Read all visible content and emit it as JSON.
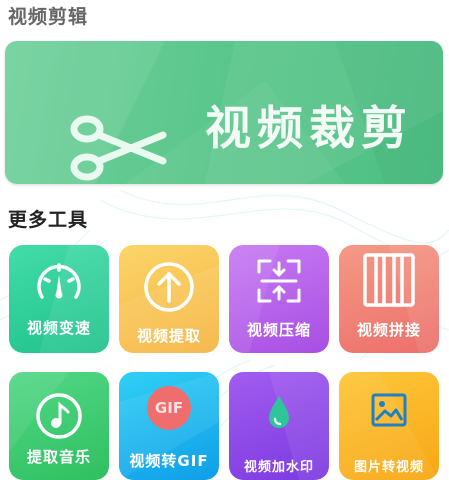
{
  "sections": {
    "edit_title": "视频剪辑",
    "more_title": "更多工具"
  },
  "banner": {
    "label": "视频裁剪",
    "icon": "scissors-icon"
  },
  "tools": [
    {
      "label": "视频变速",
      "icon": "speedometer-icon"
    },
    {
      "label": "视频提取",
      "icon": "arrow-up-circle-icon"
    },
    {
      "label": "视频压缩",
      "icon": "compress-icon"
    },
    {
      "label": "视频拼接",
      "icon": "film-strip-icon"
    },
    {
      "label": "提取音乐",
      "icon": "music-note-icon"
    },
    {
      "label": "视频转GIF",
      "icon": "gif-icon",
      "icon_text": "GIF"
    },
    {
      "label": "视频加水印",
      "icon": "water-drop-icon"
    },
    {
      "label": "图片转视频",
      "icon": "image-icon"
    }
  ],
  "colors": {
    "banner": "#5cc78c",
    "speed": "#2ecc9a",
    "extract": "#f8c252",
    "compress": "#b55ee8",
    "splice": "#ef7f72",
    "music": "#3cc86c",
    "gif": "#1fb2ef",
    "watermark": "#8b48e6",
    "img2video": "#fbb11c"
  }
}
